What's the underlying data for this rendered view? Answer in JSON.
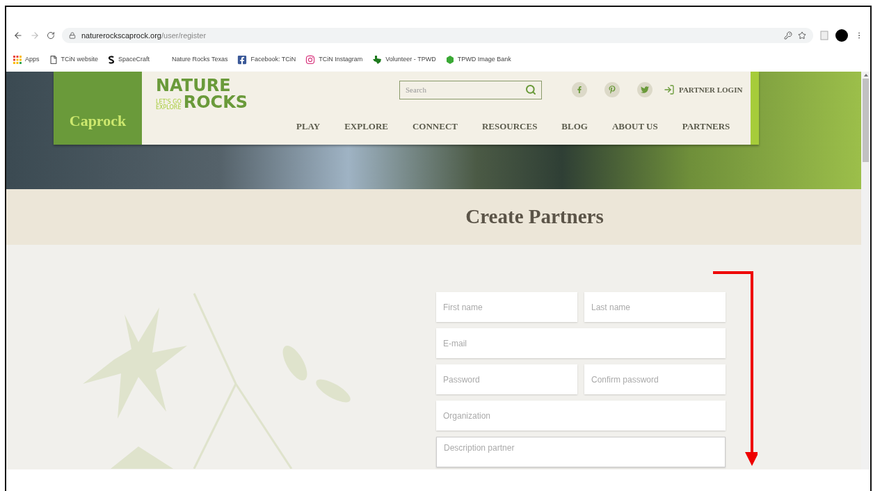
{
  "browser": {
    "url": {
      "domain": "naturerockscaprock.org",
      "path": "/user/register"
    },
    "bookmarks": [
      {
        "label": "Apps",
        "kind": "apps"
      },
      {
        "label": "TCiN website",
        "kind": "page"
      },
      {
        "label": "SpaceCraft",
        "kind": "s"
      },
      {
        "label": "Nature Rocks Texas",
        "kind": "none"
      },
      {
        "label": "Facebook: TCiN",
        "kind": "facebook"
      },
      {
        "label": "TCiN Instagram",
        "kind": "instagram"
      },
      {
        "label": "Volunteer - TPWD",
        "kind": "texas"
      },
      {
        "label": "TPWD Image Bank",
        "kind": "tpwd"
      }
    ]
  },
  "site": {
    "region": "Caprock",
    "logo": {
      "top": "NATURE",
      "small": [
        "LET'S GO",
        "EXPLORE"
      ],
      "bottom": "ROCKS"
    },
    "search": {
      "placeholder": "Search"
    },
    "social": [
      {
        "kind": "facebook"
      },
      {
        "kind": "pinterest"
      },
      {
        "kind": "twitter"
      }
    ],
    "partner_login": "PARTNER LOGIN",
    "nav": [
      "PLAY",
      "EXPLORE",
      "CONNECT",
      "RESOURCES",
      "BLOG",
      "ABOUT US",
      "PARTNERS"
    ]
  },
  "page_title": "Create Partners",
  "form": {
    "rows": [
      [
        {
          "placeholder": "First name",
          "kind": "input"
        },
        {
          "placeholder": "Last name",
          "kind": "input"
        }
      ],
      [
        {
          "placeholder": "E-mail",
          "kind": "input"
        }
      ],
      [
        {
          "placeholder": "Password",
          "kind": "input"
        },
        {
          "placeholder": "Confirm password",
          "kind": "input"
        }
      ],
      [
        {
          "placeholder": "Organization",
          "kind": "input"
        }
      ],
      [
        {
          "placeholder": "Description partner",
          "kind": "textarea"
        }
      ]
    ]
  }
}
